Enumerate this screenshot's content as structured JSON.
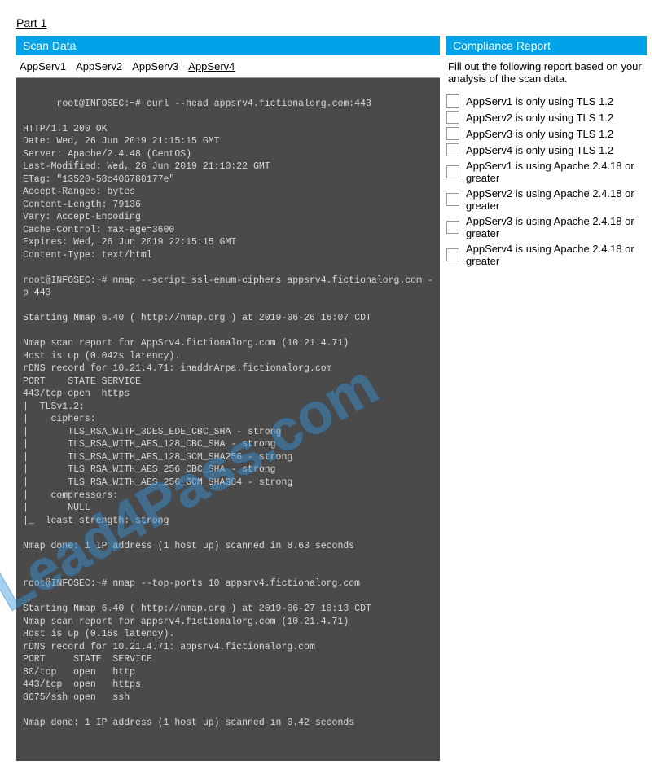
{
  "part_label": "Part 1",
  "left": {
    "header": "Scan Data",
    "tabs": [
      "AppServ1",
      "AppServ2",
      "AppServ3",
      "AppServ4"
    ],
    "active_tab_index": 3,
    "terminal": "root@INFOSEC:~# curl --head appsrv4.fictionalorg.com:443\n\nHTTP/1.1 200 OK\nDate: Wed, 26 Jun 2019 21:15:15 GMT\nServer: Apache/2.4.48 (CentOS)\nLast-Modified: Wed, 26 Jun 2019 21:10:22 GMT\nETag: \"13520-58c406780177e\"\nAccept-Ranges: bytes\nContent-Length: 79136\nVary: Accept-Encoding\nCache-Control: max-age=3600\nExpires: Wed, 26 Jun 2019 22:15:15 GMT\nContent-Type: text/html\n\nroot@INFOSEC:~# nmap --script ssl-enum-ciphers appsrv4.fictionalorg.com -p 443\n\nStarting Nmap 6.40 ( http://nmap.org ) at 2019-06-26 16:07 CDT\n\nNmap scan report for AppSrv4.fictionalorg.com (10.21.4.71)\nHost is up (0.042s latency).\nrDNS record for 10.21.4.71: inaddrArpa.fictionalorg.com\nPORT    STATE SERVICE\n443/tcp open  https\n|  TLSv1.2:\n|    ciphers:\n|       TLS_RSA_WITH_3DES_EDE_CBC_SHA - strong\n|       TLS_RSA_WITH_AES_128_CBC_SHA - strong\n|       TLS_RSA_WITH_AES_128_GCM_SHA256 - strong\n|       TLS_RSA_WITH_AES_256_CBC_SHA - strong\n|       TLS_RSA_WITH_AES_256_GCM_SHA384 - strong\n|    compressors:\n|       NULL\n|_  least strength: strong\n\nNmap done: 1 IP address (1 host up) scanned in 8.63 seconds\n\n\nroot@INFOSEC:~# nmap --top-ports 10 appsrv4.fictionalorg.com\n\nStarting Nmap 6.40 ( http://nmap.org ) at 2019-06-27 10:13 CDT\nNmap scan report for appsrv4.fictionalorg.com (10.21.4.71)\nHost is up (0.15s latency).\nrDNS record for 10.21.4.71: appsrv4.fictionalorg.com\nPORT     STATE  SERVICE\n80/tcp   open   http\n443/tcp  open   https\n8675/ssh open   ssh\n\nNmap done: 1 IP address (1 host up) scanned in 0.42 seconds"
  },
  "right": {
    "header": "Compliance Report",
    "instruction": "Fill out the following report based on your analysis of the scan data.",
    "items": [
      "AppServ1 is only using TLS 1.2",
      "AppServ2 is only using TLS 1.2",
      "AppServ3 is only using TLS 1.2",
      "AppServ4 is only using TLS 1.2",
      "AppServ1 is using Apache 2.4.18 or greater",
      "AppServ2 is using Apache 2.4.18 or greater",
      "AppServ3 is using Apache 2.4.18 or greater",
      "AppServ4 is using Apache 2.4.18 or greater"
    ]
  },
  "watermark": "Lead4Pass.com"
}
